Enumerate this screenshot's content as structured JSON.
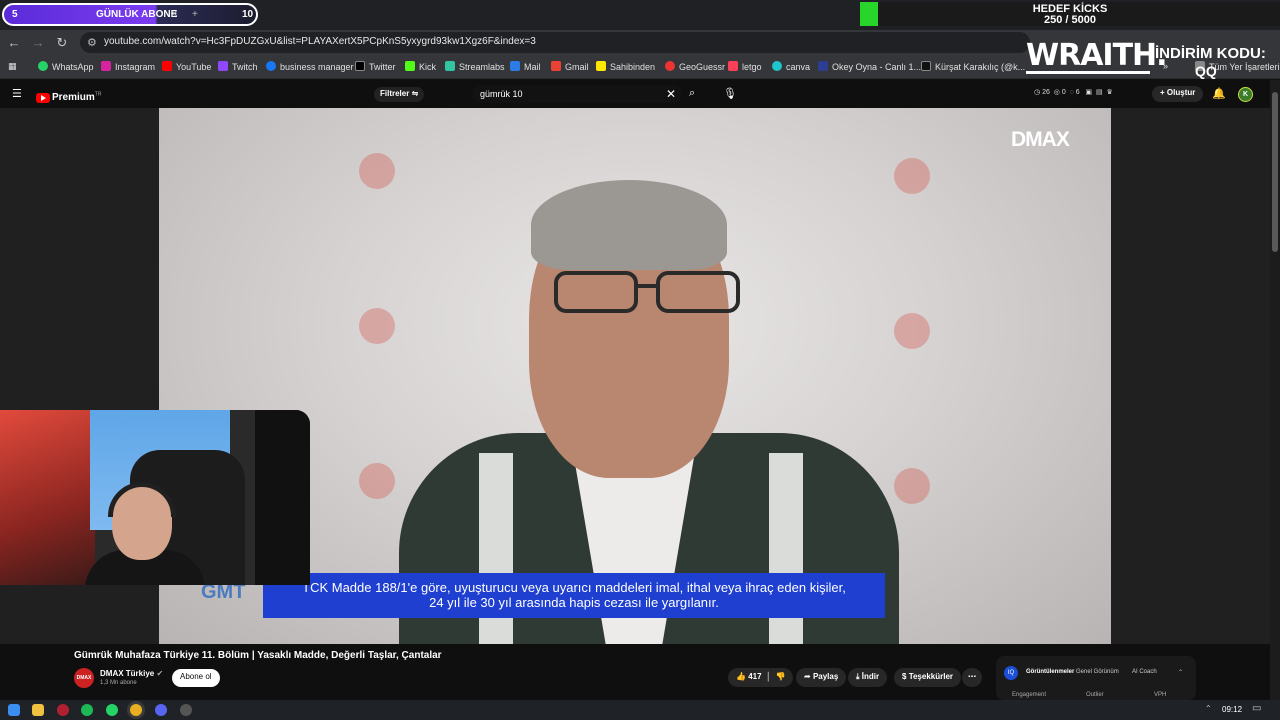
{
  "stream_overlay": {
    "sub_goal_current": "5",
    "sub_goal_label": "GÜNLÜK ABONE",
    "sub_goal_target": "10",
    "kick_goal_title": "HEDEF KİCKS",
    "kick_goal_progress": "250 / 5000",
    "sponsor_brand": "WRAITH.",
    "sponsor_promo": "İNDİRİM KODU:",
    "sponsor_code": "QQ"
  },
  "browser": {
    "url": "youtube.com/watch?v=Hc3FpDUZGxU&list=PLAYAXertX5PCpKnS5yxygrd93kw1Xgz6F&index=3",
    "bookmarks": [
      "WhatsApp",
      "Instagram",
      "YouTube",
      "Twitch",
      "business manager",
      "Twitter",
      "Kick",
      "Streamlabs",
      "Mail",
      "Gmail",
      "Sahibinden",
      "GeoGuessr",
      "letgo",
      "canva",
      "Okey Oyna - Canlı 1...",
      "Kürşat Karakılıç (@k...",
      "Tüm Yer İşaretleri"
    ]
  },
  "youtube": {
    "logo_label": "Premium",
    "logo_region": "TR",
    "filters_label": "Filtreler",
    "search_query": "gümrük 10",
    "stats": [
      "26",
      "0",
      "6"
    ],
    "create_label": "Oluştur",
    "avatar_letter": "K"
  },
  "video": {
    "channel_watermark": "DMAX",
    "lower_third_logo": "GMT",
    "subtitle_line1": "TCK Madde 188/1'e göre, uyuşturucu veya uyarıcı maddeleri imal, ithal veya ihraç eden kişiler,",
    "subtitle_line2": "24 yıl ile 30 yıl arasında hapis cezası ile yargılanır."
  },
  "meta": {
    "title": "Gümrük Muhafaza Türkiye 11. Bölüm | Yasaklı Madde, Değerli Taşlar, Çantalar",
    "channel_name": "DMAX Türkiye",
    "channel_subs": "1,3 Mn abone",
    "subscribe_label": "Abone ol",
    "likes": "417",
    "share_label": "Paylaş",
    "download_label": "İndir",
    "thanks_label": "Teşekkürler"
  },
  "analytics_panel": {
    "tabs": [
      "Görüntülenmeler",
      "Genel Görünüm",
      "AI Coach"
    ],
    "headers": [
      "Engagement",
      "Outlier",
      "VPH"
    ]
  },
  "taskbar": {
    "time": "09:12"
  }
}
